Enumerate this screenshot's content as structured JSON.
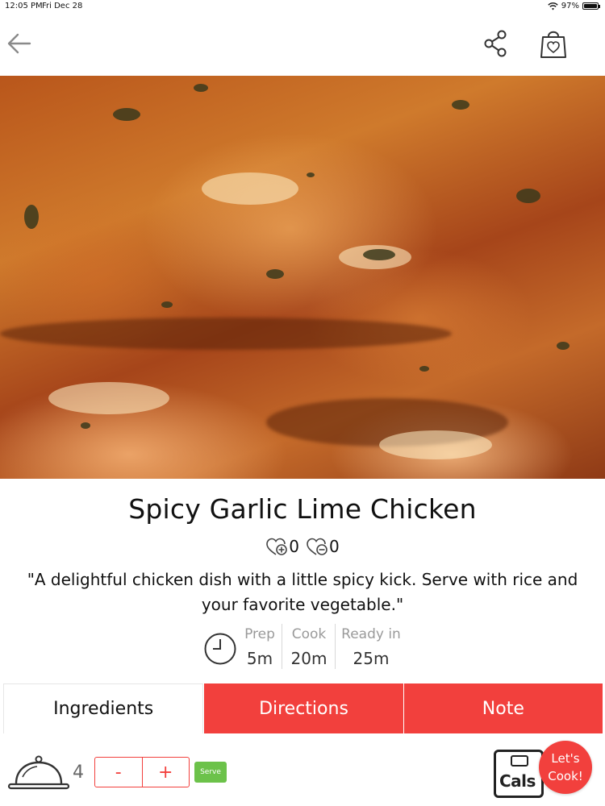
{
  "status_bar": {
    "time": "12:05 PM",
    "date": "Fri Dec 28",
    "battery": "97%",
    "battery_level": 0.97
  },
  "nav": {
    "back_icon": "arrow-left-icon",
    "share_icon": "share-icon",
    "bag_icon": "shopping-bag-heart-icon"
  },
  "hero": {
    "image_semantic": "close-up of seasoned roasted chicken pieces"
  },
  "recipe": {
    "title": "Spicy Garlic Lime Chicken",
    "likes": "0",
    "dislikes": "0",
    "description": "\"A delightful chicken dish with a little spicy kick. Serve with rice and your favorite vegetable.\""
  },
  "times": {
    "prep_label": "Prep",
    "prep_value": "5m",
    "cook_label": "Cook",
    "cook_value": "20m",
    "ready_label": "Ready in",
    "ready_value": "25m"
  },
  "tabs": [
    {
      "label": "Ingredients",
      "active": true
    },
    {
      "label": "Directions",
      "active": false
    },
    {
      "label": "Note",
      "active": false
    }
  ],
  "servings": {
    "count": "4",
    "minus": "-",
    "plus": "+",
    "serve_label": "Serve"
  },
  "actions": {
    "cals_label": "Cals",
    "lets_cook_line1": "Let's",
    "lets_cook_line2": "Cook!"
  },
  "colors": {
    "accent": "#f2403d",
    "serve_green": "#6cc24a",
    "muted_text": "#9a9a9a"
  }
}
